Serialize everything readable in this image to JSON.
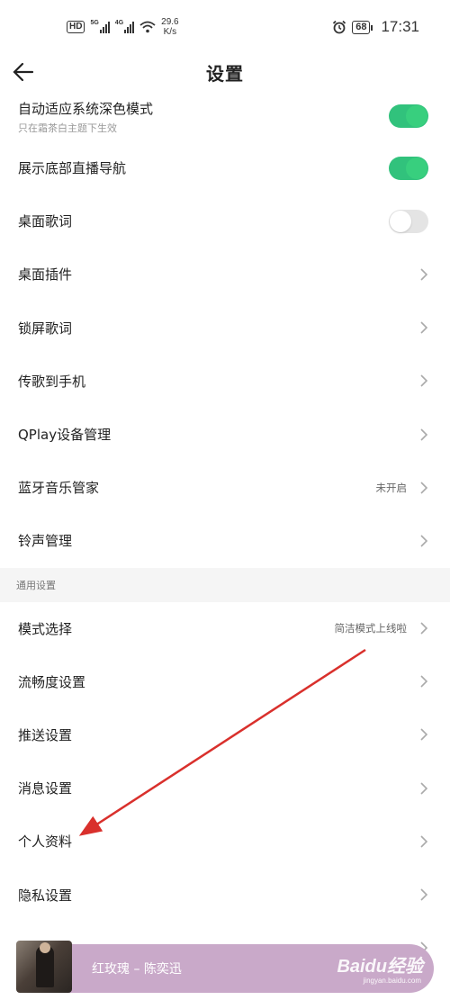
{
  "status_bar": {
    "hd": "HD",
    "sim1": "5G",
    "sim2": "4G",
    "speed_value": "29.6",
    "speed_unit": "K/s",
    "battery": "68",
    "time": "17:31"
  },
  "header": {
    "title": "设置",
    "back_icon": "back-arrow-icon"
  },
  "rows_top": [
    {
      "label": "自动适应系统深色模式",
      "sub": "只在霜茶白主题下生效",
      "control": "toggle",
      "on": true
    },
    {
      "label": "展示底部直播导航",
      "control": "toggle",
      "on": true
    },
    {
      "label": "桌面歌词",
      "control": "toggle",
      "on": false
    },
    {
      "label": "桌面插件",
      "control": "chevron"
    },
    {
      "label": "锁屏歌词",
      "control": "chevron"
    },
    {
      "label": "传歌到手机",
      "control": "chevron"
    },
    {
      "label": "QPlay设备管理",
      "control": "chevron"
    },
    {
      "label": "蓝牙音乐管家",
      "value": "未开启",
      "control": "chevron"
    },
    {
      "label": "铃声管理",
      "control": "chevron"
    }
  ],
  "section_general": "通用设置",
  "rows_general": [
    {
      "label": "模式选择",
      "value": "简洁模式上线啦",
      "control": "chevron"
    },
    {
      "label": "流畅度设置",
      "control": "chevron"
    },
    {
      "label": "推送设置",
      "control": "chevron"
    },
    {
      "label": "消息设置",
      "control": "chevron"
    },
    {
      "label": "个人资料",
      "control": "chevron"
    },
    {
      "label": "隐私设置",
      "control": "chevron"
    }
  ],
  "player": {
    "song": "红玫瑰 – 陈奕迅"
  },
  "watermark": {
    "text": "Baidu经验",
    "sub": "jingyan.baidu.com"
  },
  "colors": {
    "toggle_on": "#31c27c",
    "toggle_off": "#e4e4e4",
    "player_bg": "#c9a9c9",
    "annotation_arrow": "#d9302c"
  }
}
